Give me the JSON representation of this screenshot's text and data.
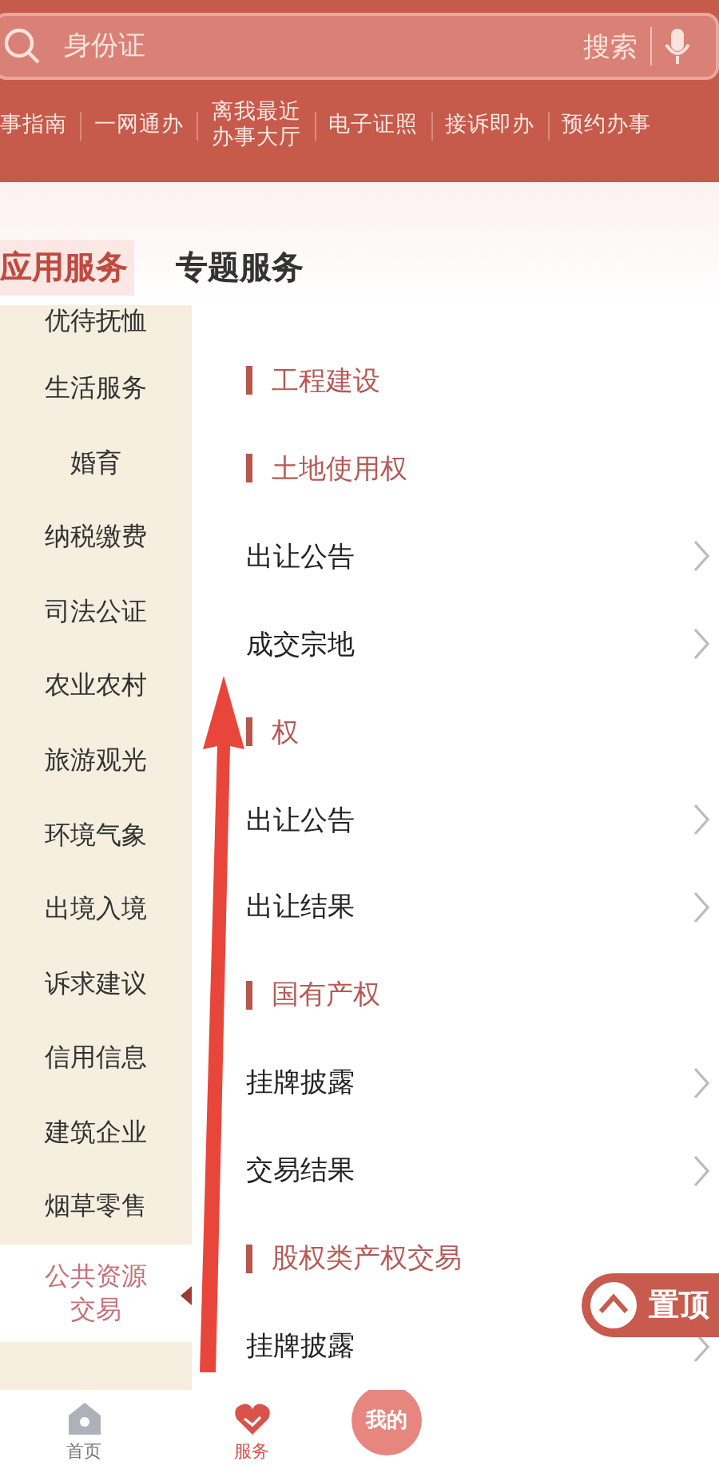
{
  "search": {
    "placeholder": "身份证",
    "button": "搜索"
  },
  "quick_links": [
    "事指南",
    "一网通办",
    "离我最近办事大厅",
    "电子证照",
    "接诉即办",
    "预约办事"
  ],
  "tabs": [
    {
      "label": "应用服务",
      "selected": true
    },
    {
      "label": "专题服务",
      "selected": false
    }
  ],
  "sidebar": {
    "items": [
      {
        "label": "优待抚恤",
        "selected": false
      },
      {
        "label": "生活服务",
        "selected": false
      },
      {
        "label": "婚育",
        "selected": false
      },
      {
        "label": "纳税缴费",
        "selected": false
      },
      {
        "label": "司法公证",
        "selected": false
      },
      {
        "label": "农业农村",
        "selected": false
      },
      {
        "label": "旅游观光",
        "selected": false
      },
      {
        "label": "环境气象",
        "selected": false
      },
      {
        "label": "出境入境",
        "selected": false
      },
      {
        "label": "诉求建议",
        "selected": false
      },
      {
        "label": "信用信息",
        "selected": false
      },
      {
        "label": "建筑企业",
        "selected": false
      },
      {
        "label": "烟草零售",
        "selected": false
      },
      {
        "label": "公共资源交易",
        "selected": true
      }
    ]
  },
  "content": [
    {
      "kind": "section",
      "label": "工程建设"
    },
    {
      "kind": "section",
      "label": "土地使用权"
    },
    {
      "kind": "link",
      "label": "出让公告"
    },
    {
      "kind": "link",
      "label": "成交宗地"
    },
    {
      "kind": "section",
      "label": "权"
    },
    {
      "kind": "link",
      "label": "出让公告"
    },
    {
      "kind": "link",
      "label": "出让结果"
    },
    {
      "kind": "section",
      "label": "国有产权"
    },
    {
      "kind": "link",
      "label": "挂牌披露"
    },
    {
      "kind": "link",
      "label": "交易结果"
    },
    {
      "kind": "section",
      "label": "股权类产权交易"
    },
    {
      "kind": "link",
      "label": "挂牌披露"
    }
  ],
  "back_to_top": "置顶",
  "bottom_nav": [
    {
      "label": "首页",
      "kind": "home",
      "selected": false
    },
    {
      "label": "服务",
      "kind": "service",
      "selected": true
    },
    {
      "label": "我的",
      "kind": "mine",
      "selected": false
    }
  ]
}
